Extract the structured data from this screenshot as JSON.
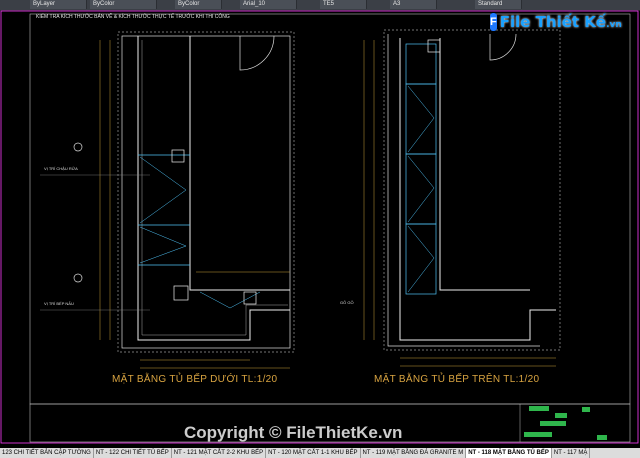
{
  "toolbar": {
    "items": [
      "ByLayer",
      "ByColor",
      "ByColor",
      "Arial_10",
      "TE5",
      "A3",
      "Standard"
    ]
  },
  "note": "KIỂM TRA KÍCH THƯỚC BẢN VẼ & KÍCH THƯỚC THỰC TẾ TRƯỚC KHI THI CÔNG",
  "logo": {
    "mark": "F",
    "text": "File Thiết Kế",
    "suffix": ".vn"
  },
  "drawing": {
    "title_left": "MẶT BẰNG TỦ BẾP DƯỚI    TL:1/20",
    "title_right": "MẶT BẰNG TỦ BẾP TRÊN    TL:1/20",
    "label_sink": "VỊ TRÍ CHẬU RỬA",
    "label_stove": "VỊ TRÍ BẾP NẤU",
    "label_wood": "GỖ GỖ"
  },
  "watermark": "Copyright © FileThietKe.vn",
  "tabs": [
    "123 CHI TIẾT BẢN CẬP TƯỜNG",
    "NT - 122 CHI TIẾT TỦ BẾP",
    "NT - 121 MẶT CẮT 2-2 KHU BẾP",
    "NT - 120 MẶT CẮT 1-1 KHU BẾP",
    "NT - 119 MẶT BẰNG ĐÁ GRANITE M",
    "NT - 118 MẶT BẰNG TỦ BẾP",
    "NT - 117 MẶ"
  ],
  "active_tab": 5,
  "colors": {
    "wall": "#d9d9d9",
    "cabinet": "#e0e0e0",
    "dim": "#c9a13b",
    "cyan": "#4fc3f7",
    "magenta": "#ff3cff"
  }
}
